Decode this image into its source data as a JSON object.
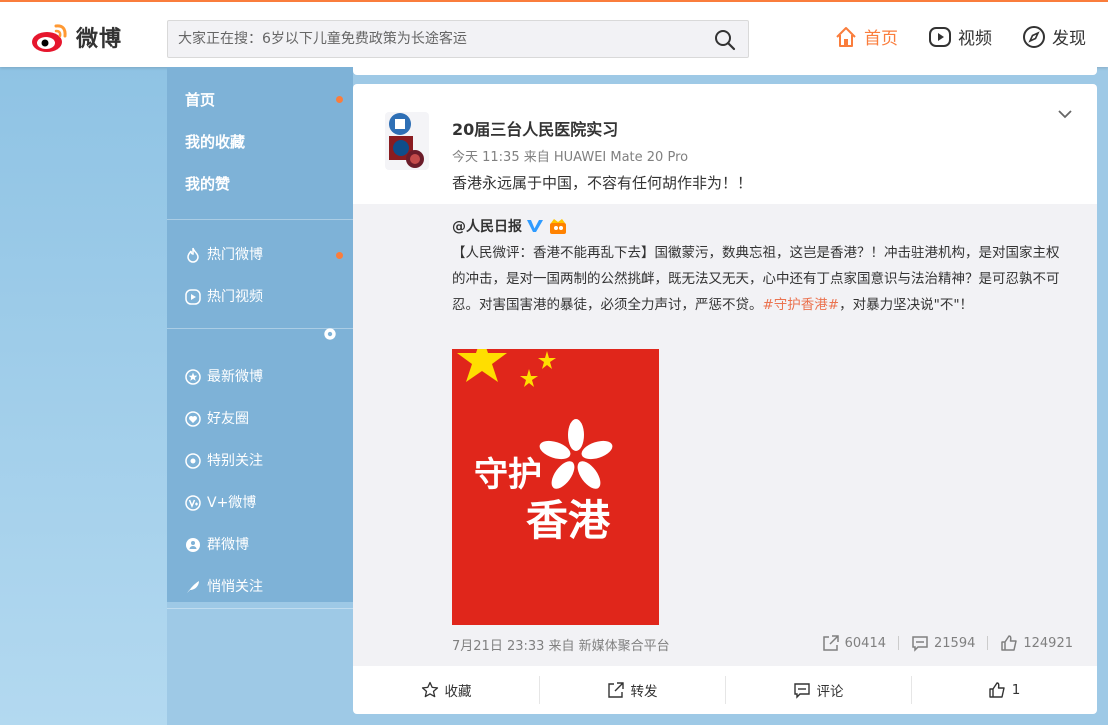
{
  "header": {
    "logo_text": "微博",
    "search_placeholder": "大家正在搜：6岁以下儿童免费政策为长途客运",
    "nav": [
      {
        "label": "首页",
        "icon": "home-icon",
        "active": true
      },
      {
        "label": "视频",
        "icon": "video-icon",
        "active": false
      },
      {
        "label": "发现",
        "icon": "compass-icon",
        "active": false
      }
    ],
    "accent": "#fa7d3c"
  },
  "sidebar": {
    "main": [
      {
        "label": "首页",
        "dot": true
      },
      {
        "label": "我的收藏",
        "dot": false
      },
      {
        "label": "我的赞",
        "dot": false
      }
    ],
    "section1": [
      {
        "label": "热门微博",
        "icon": "flame-icon",
        "dot": true
      },
      {
        "label": "热门视频",
        "icon": "play-circle-icon",
        "dot": false
      }
    ],
    "section2": [
      {
        "label": "最新微博",
        "icon": "star-circle-icon"
      },
      {
        "label": "好友圈",
        "icon": "heart-circle-icon"
      },
      {
        "label": "特别关注",
        "icon": "eye-circle-icon"
      },
      {
        "label": "V+微博",
        "icon": "v-plus-icon"
      },
      {
        "label": "群微博",
        "icon": "group-icon"
      },
      {
        "label": "悄悄关注",
        "icon": "feather-icon"
      }
    ]
  },
  "post": {
    "author": "20届三台人民医院实习",
    "meta": "今天 11:35 来自 HUAWEI Mate 20 Pro",
    "text": "香港永远属于中国，不容有任何胡作非为！！",
    "repost": {
      "user": "@人民日报",
      "text_main": "【人民微评：香港不能再乱下去】国徽蒙污，数典忘祖，这岂是香港？！冲击驻港机构，是对国家主权的冲击，是对一国两制的公然挑衅，既无法又无天，心中还有丁点家国意识与法治精神？是可忍孰不可忍。对害国害港的暴徒，必须全力声讨，严惩不贷。",
      "hashtag": "#守护香港#",
      "text_end": "，对暴力坚决说\"不\"！",
      "image_text_1": "守护",
      "image_text_2": "香港",
      "footer": "7月21日 23:33 来自 新媒体聚合平台",
      "reposts": "60414",
      "comments": "21594",
      "likes": "124921"
    },
    "actions": {
      "favorite": "收藏",
      "repost": "转发",
      "comment": "评论",
      "like": "1"
    }
  }
}
